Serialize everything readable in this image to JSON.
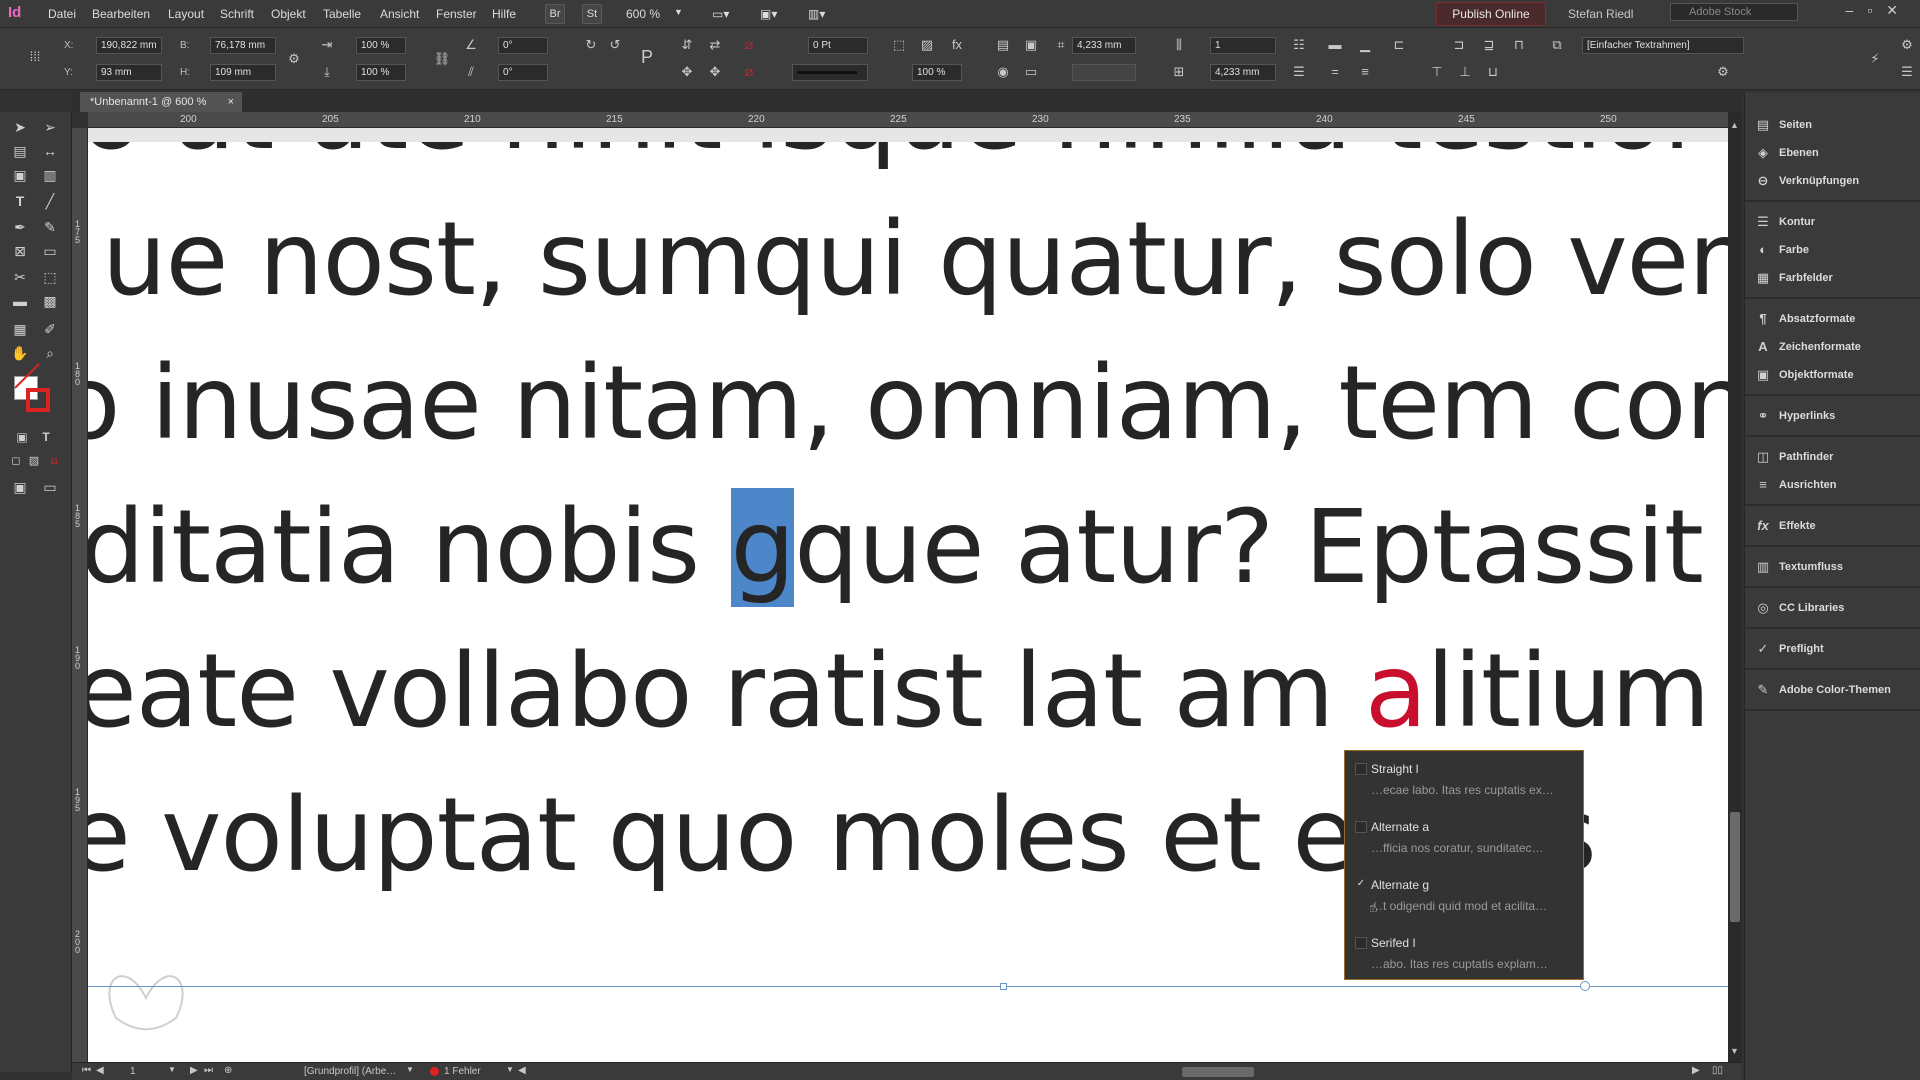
{
  "app": {
    "logo": "Id"
  },
  "menu": [
    "Datei",
    "Bearbeiten",
    "Layout",
    "Schrift",
    "Objekt",
    "Tabelle",
    "Ansicht",
    "Fenster",
    "Hilfe"
  ],
  "bridge_labels": {
    "br": "Br",
    "st": "St"
  },
  "zoom": "600 %",
  "publish_label": "Publish Online",
  "user_name": "Stefan Riedl",
  "stock_placeholder": "Adobe Stock",
  "control": {
    "x_label": "X:",
    "x": "190,822 mm",
    "y_label": "Y:",
    "y": "93 mm",
    "w_label": "B:",
    "w": "76,178 mm",
    "h_label": "H:",
    "h": "109 mm",
    "scale_x": "100 %",
    "scale_y": "100 %",
    "rotate": "0°",
    "shear": "0°",
    "stroke_weight": "0 Pt",
    "opacity": "100 %",
    "gutter_top": "4,233 mm",
    "gutter_bottom": "4,233 mm",
    "columns": "1",
    "object_style": "[Einfacher Textrahmen]"
  },
  "tab": {
    "title": "*Unbenannt-1 @ 600 %",
    "close": "×"
  },
  "ruler_top": [
    "200",
    "205",
    "210",
    "215",
    "220",
    "225",
    "230",
    "235",
    "240",
    "245",
    "250"
  ],
  "ruler_left": [
    "1\n7\n5",
    "1\n8\n0",
    "1\n8\n5",
    "1\n9\n0",
    "1\n9\n5",
    "2\n0\n0"
  ],
  "text_lines": [
    {
      "text": "o at ute nihit isque nihilla testior"
    },
    {
      "text": "ue nost, sumqui quatur, solo ven"
    },
    {
      "text": "o inusae nitam, omniam, tem con"
    },
    {
      "before": "ditatia nobis ",
      "highlight": "g",
      "after": "que atur? Eptassit"
    },
    {
      "before": "eate vollabo ratist lat am ",
      "red": "a",
      "after": "litium d"
    },
    {
      "text": "e voluptat quo moles et ex res"
    }
  ],
  "glyph_options": [
    {
      "name": "Straight l",
      "sample": "…ecae labo. Itas res cuptatis ex…",
      "checked": ""
    },
    {
      "name": "Alternate a",
      "sample": "…fficia nos coratur, sunditatec…",
      "checked": ""
    },
    {
      "name": "Alternate g",
      "sample": "…t odigendi quid mod et acilita…",
      "checked": "✓"
    },
    {
      "name": "Serifed I",
      "sample": "…abo. Itas res cuptatis explam…",
      "checked": ""
    }
  ],
  "status": {
    "page": "1",
    "profile": "[Grundprofil] (Arbe…",
    "errors": "1 Fehler"
  },
  "panels": [
    {
      "label": "Seiten",
      "icon": "pages-icon",
      "glyph": "▤"
    },
    {
      "label": "Ebenen",
      "icon": "layers-icon",
      "glyph": "◈"
    },
    {
      "label": "Verknüpfungen",
      "icon": "links-icon",
      "glyph": "⊖"
    },
    {
      "label": "Kontur",
      "icon": "stroke-icon",
      "glyph": "☰"
    },
    {
      "label": "Farbe",
      "icon": "color-icon",
      "glyph": "◐"
    },
    {
      "label": "Farbfelder",
      "icon": "swatches-icon",
      "glyph": "▦"
    },
    {
      "label": "Absatzformate",
      "icon": "paragraph-styles-icon",
      "glyph": "¶"
    },
    {
      "label": "Zeichenformate",
      "icon": "character-styles-icon",
      "glyph": "A"
    },
    {
      "label": "Objektformate",
      "icon": "object-styles-icon",
      "glyph": "▣"
    },
    {
      "label": "Hyperlinks",
      "icon": "hyperlinks-icon",
      "glyph": "⚭"
    },
    {
      "label": "Pathfinder",
      "icon": "pathfinder-icon",
      "glyph": "◫"
    },
    {
      "label": "Ausrichten",
      "icon": "align-icon",
      "glyph": "≡"
    },
    {
      "label": "Effekte",
      "icon": "effects-icon",
      "glyph": "fx"
    },
    {
      "label": "Textumfluss",
      "icon": "text-wrap-icon",
      "glyph": "▥"
    },
    {
      "label": "CC Libraries",
      "icon": "cc-libraries-icon",
      "glyph": "◎"
    },
    {
      "label": "Preflight",
      "icon": "preflight-icon",
      "glyph": "✓"
    },
    {
      "label": "Adobe Color-Themen",
      "icon": "color-themes-icon",
      "glyph": "✎"
    }
  ],
  "colors": {
    "highlight": "#4d86c9",
    "alternate_red": "#c8102e",
    "popup_border": "#9a6a2a"
  }
}
